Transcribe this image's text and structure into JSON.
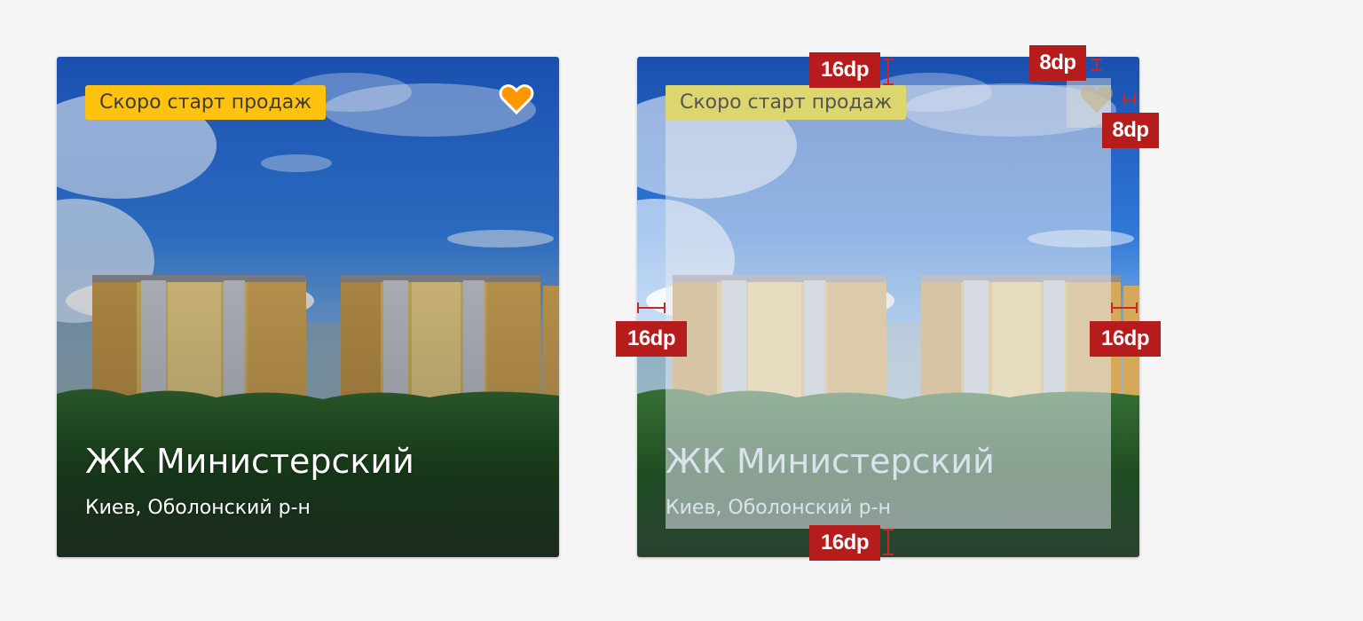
{
  "cards": [
    {
      "badge": "Скоро старт продаж",
      "title": "ЖК Министерский",
      "subtitle": "Киев, Оболонский р-н",
      "favorite_icon": "heart-icon",
      "favorite_color": "#ff9800"
    },
    {
      "badge": "Скоро старт продаж",
      "title": "ЖК Министерский",
      "subtitle": "Киев, Оболонский р-н",
      "favorite_icon": "heart-icon",
      "favorite_color": "#c5b27a"
    }
  ],
  "spec": {
    "top_padding": "16dp",
    "heart_top": "8dp",
    "heart_right": "8dp",
    "left_padding": "16dp",
    "right_padding": "16dp",
    "bottom_padding": "16dp",
    "marker_color": "#b71c1c",
    "overlay_color": "#e1e7ee"
  },
  "colors": {
    "badge": "#ffc20e",
    "page_background": "#f5f5f5"
  }
}
